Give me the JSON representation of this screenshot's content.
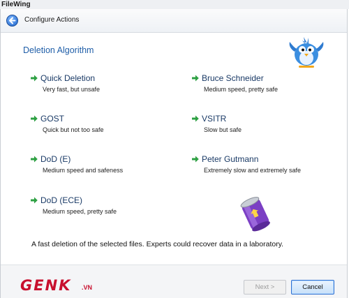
{
  "window": {
    "title": "FileWing"
  },
  "header": {
    "breadcrumb": "Configure Actions"
  },
  "section_title": "Deletion Algorithm",
  "options": [
    {
      "label": "Quick Deletion",
      "desc": "Very fast, but unsafe"
    },
    {
      "label": "GOST",
      "desc": "Quick but not too safe"
    },
    {
      "label": "DoD (E)",
      "desc": "Medium speed and safeness"
    },
    {
      "label": "DoD (ECE)",
      "desc": "Medium speed, pretty safe"
    },
    {
      "label": "Bruce Schneider",
      "desc": "Medium speed, pretty safe"
    },
    {
      "label": "VSITR",
      "desc": "Slow but safe"
    },
    {
      "label": "Peter Gutmann",
      "desc": "Extremely slow and extremely safe"
    }
  ],
  "status_text": "A fast deletion of the selected files. Experts could recover data in a laboratory.",
  "footer": {
    "logo": "GENK",
    "logo_suffix": ".VN",
    "next_label": "Next >",
    "cancel_label": "Cancel"
  },
  "colors": {
    "accent": "#1f5ea8",
    "arrow": "#2ea043",
    "logo": "#c8102e"
  }
}
